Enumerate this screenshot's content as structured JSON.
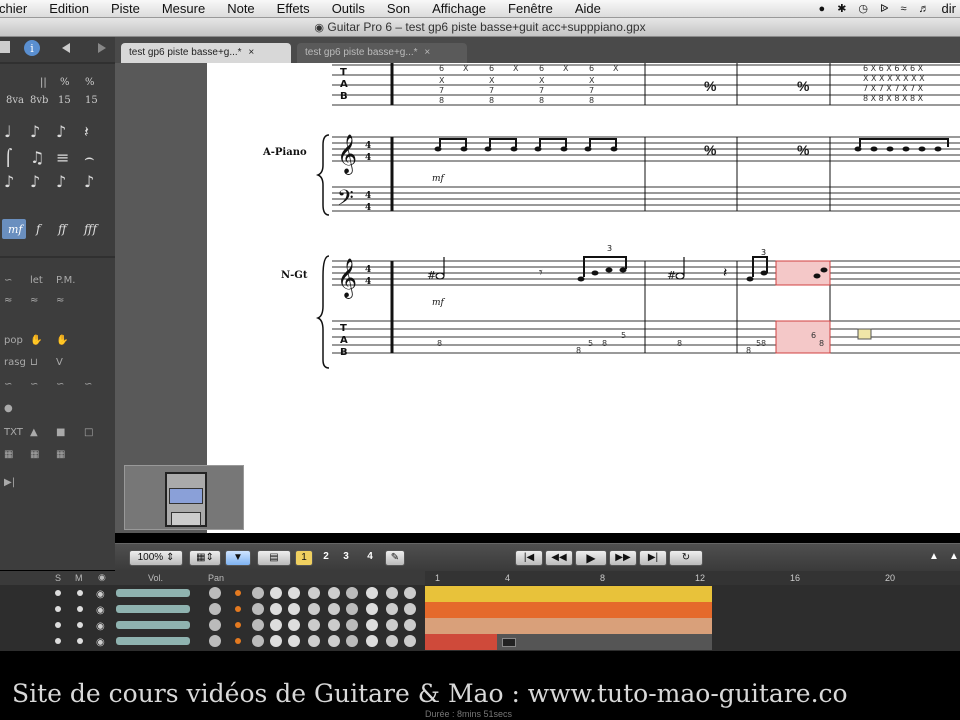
{
  "menubar": {
    "items": [
      "chier",
      "Edition",
      "Piste",
      "Mesure",
      "Note",
      "Effets",
      "Outils",
      "Son",
      "Affichage",
      "Fenêtre",
      "Aide"
    ],
    "right_text": "dir"
  },
  "window": {
    "title": "Guitar Pro 6 – test gp6 piste basse+guit acc+supppiano.gpx"
  },
  "tabs": [
    {
      "label": "test gp6 piste basse+g...*",
      "active": true
    },
    {
      "label": "test gp6 piste basse+g...*",
      "active": false
    }
  ],
  "score": {
    "tracks": [
      {
        "name": "A-Piano"
      },
      {
        "name": "N-Gt"
      }
    ],
    "time_signature": "4/4",
    "dynamics": [
      "mf",
      "mf"
    ],
    "tab_letters": [
      "T",
      "A",
      "B"
    ],
    "tab_top_numbers": [
      "6",
      "X",
      "6",
      "X",
      "6",
      "X",
      "6",
      "X"
    ],
    "tab_nums_ngt": [
      "8",
      "8",
      "5",
      "8",
      "5",
      "8",
      "8",
      "5",
      "8",
      "6",
      "8"
    ],
    "triplets": [
      "3",
      "3"
    ]
  },
  "toolbar_bottom": {
    "zoom": "100%",
    "voices": [
      "1",
      "2",
      "3",
      "4"
    ]
  },
  "mixer": {
    "headers": {
      "solo": "S",
      "mute": "M",
      "vol": "Vol.",
      "pan": "Pan"
    },
    "timeline_markers": [
      "1",
      "4",
      "8",
      "12",
      "16",
      "20"
    ],
    "status_text": "Durée : 8mins 51secs"
  },
  "footer": {
    "caption": "Site de cours vidéos de Guitare & Mao : www.tuto-mao-guitare.co"
  },
  "colors": {
    "track_yellow": "#e8c23a",
    "track_orange": "#e56a2b",
    "track_tan": "#d9a07a",
    "track_red": "#cf4a3a",
    "score_bg": "#ffffff"
  }
}
